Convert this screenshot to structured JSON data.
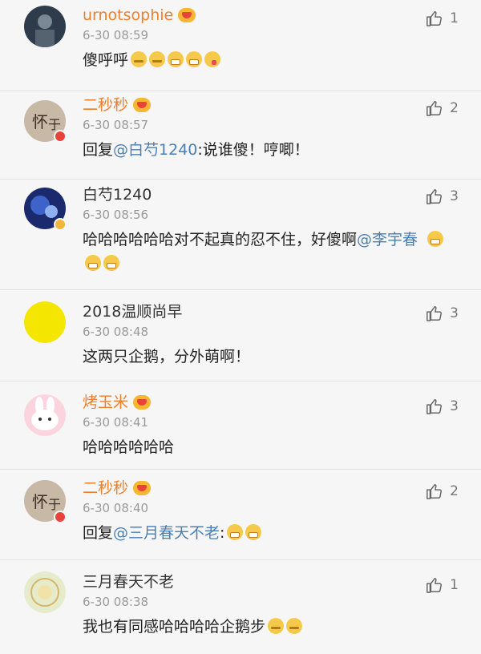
{
  "comments": [
    {
      "name": "urnotsophie",
      "time": "6-30 08:59",
      "text": "傻呼呼",
      "mention": "",
      "tail": "",
      "likes": "1"
    },
    {
      "name": "二秒秒",
      "time": "6-30 08:57",
      "text": "回复",
      "mention": "@白芍1240",
      "tail": ":说谁傻！哼唧！",
      "likes": "2"
    },
    {
      "name": "白芍1240",
      "time": "6-30 08:56",
      "text": "哈哈哈哈哈哈对不起真的忍不住，好傻啊",
      "mention": "@李宇春",
      "tail": "",
      "likes": "3"
    },
    {
      "name": "2018温顺尚早",
      "time": "6-30 08:48",
      "text": "这两只企鹅，分外萌啊！",
      "mention": "",
      "tail": "",
      "likes": "3"
    },
    {
      "name": "烤玉米",
      "time": "6-30 08:41",
      "text": "哈哈哈哈哈哈",
      "mention": "",
      "tail": "",
      "likes": "3"
    },
    {
      "name": "二秒秒",
      "time": "6-30 08:40",
      "text": "回复",
      "mention": "@三月春天不老",
      "tail": ":",
      "likes": "2"
    },
    {
      "name": "三月春天不老",
      "time": "6-30 08:38",
      "text": "我也有同感哈哈哈哈企鹅步",
      "mention": "",
      "tail": "",
      "likes": "1"
    }
  ]
}
